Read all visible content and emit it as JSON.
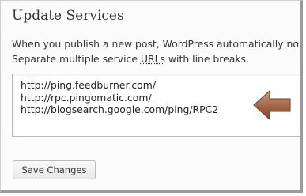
{
  "heading": "Update Services",
  "description": {
    "line1": "When you publish a new post, WordPress automatically no",
    "line2_prefix": "Separate multiple service ",
    "line2_abbr": "URLs",
    "line2_suffix": " with line breaks."
  },
  "ping_services": [
    "http://ping.feedburner.com/",
    "http://rpc.pingomatic.com/",
    "http://blogsearch.google.com/ping/RPC2"
  ],
  "save_button": "Save Changes",
  "colors": {
    "arrow": "#a4684c",
    "button_bg": "#eeeeee"
  },
  "icons": {
    "callout": "arrow-left-icon"
  }
}
